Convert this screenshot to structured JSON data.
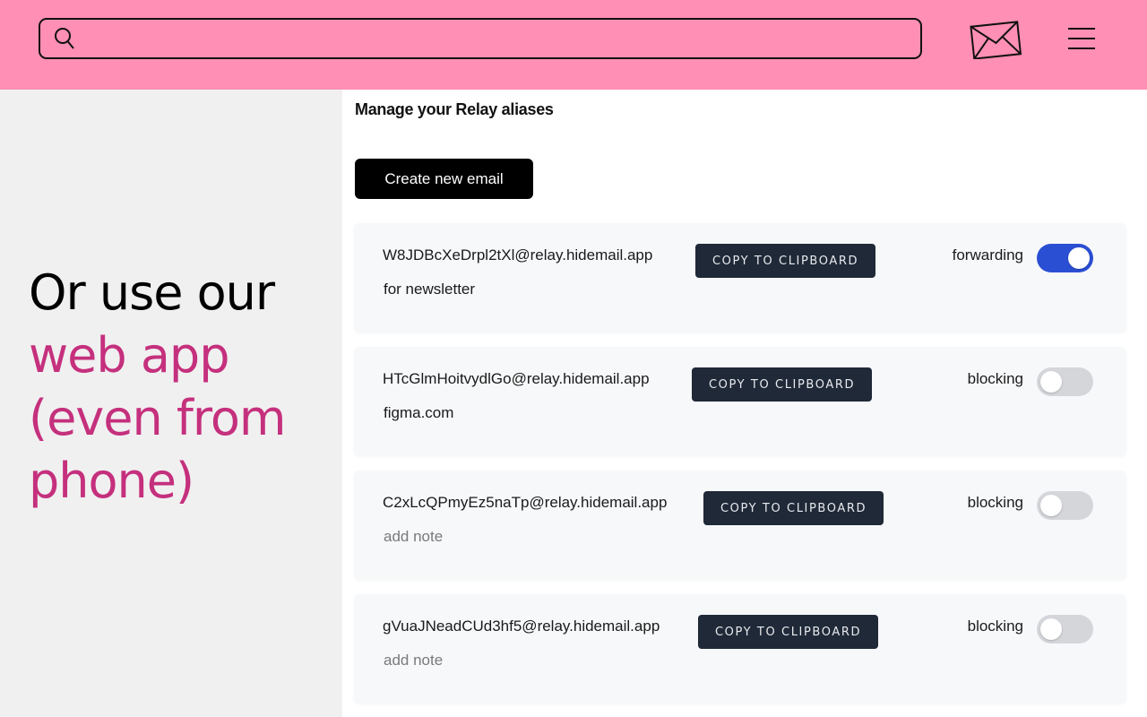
{
  "header": {
    "search_placeholder": "",
    "search_value": "",
    "icons": {
      "search": "search-icon",
      "mail": "envelope-icon",
      "menu": "hamburger-menu-icon"
    },
    "background_color": "#ff8fb4"
  },
  "promo": {
    "line1": "Or use our",
    "line2": "web app",
    "line3": "(even from",
    "line4": "phone)",
    "accent_color": "#c5307d"
  },
  "panel": {
    "title": "Manage your Relay aliases",
    "create_button": "Create new email",
    "aliases": [
      {
        "email": "W8JDBcXeDrpl2tXl@relay.hidemail.app",
        "note": "for newsletter",
        "note_is_placeholder": false,
        "copy_label": "COPY TO CLIPBOARD",
        "status": "forwarding",
        "enabled": true
      },
      {
        "email": "HTcGlmHoitvydlGo@relay.hidemail.app",
        "note": "figma.com",
        "note_is_placeholder": false,
        "copy_label": "COPY TO CLIPBOARD",
        "status": "blocking",
        "enabled": false
      },
      {
        "email": "C2xLcQPmyEz5naTp@relay.hidemail.app",
        "note": "add note",
        "note_is_placeholder": true,
        "copy_label": "COPY TO CLIPBOARD",
        "status": "blocking",
        "enabled": false
      },
      {
        "email": "gVuaJNeadCUd3hf5@relay.hidemail.app",
        "note": "add note",
        "note_is_placeholder": true,
        "copy_label": "COPY TO CLIPBOARD",
        "status": "blocking",
        "enabled": false
      }
    ],
    "toggle_on_color": "#2b4fd3",
    "copy_button_color": "#1f2937"
  }
}
